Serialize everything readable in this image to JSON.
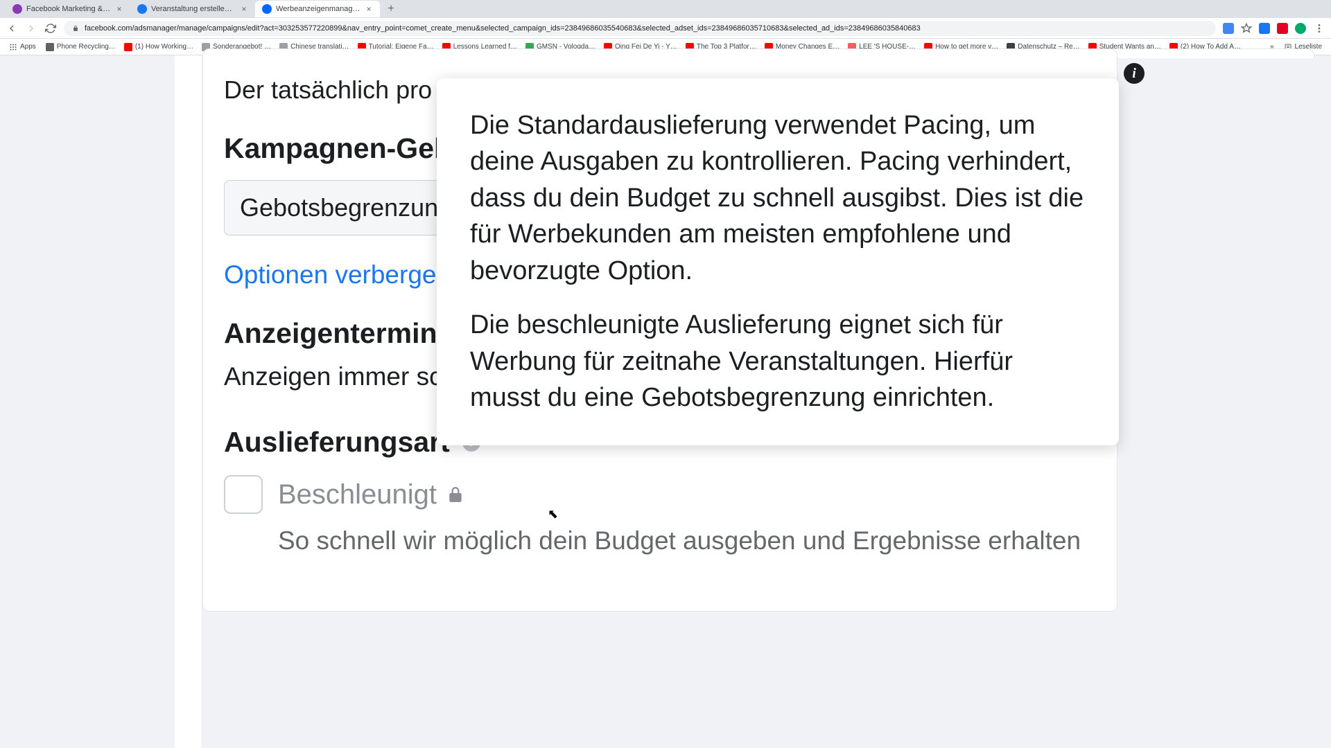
{
  "browser": {
    "tabs": [
      {
        "title": "Facebook Marketing & Werbe…",
        "favicon": "#8a3ab9"
      },
      {
        "title": "Veranstaltung erstellen | Face…",
        "favicon": "#1877f2"
      },
      {
        "title": "Werbeanzeigenmanager - We…",
        "favicon": "#0866ff"
      }
    ],
    "url": "facebook.com/adsmanager/manage/campaigns/edit?act=303253577220899&nav_entry_point=comet_create_menu&selected_campaign_ids=23849686035540683&selected_adset_ids=23849686035710683&selected_ad_ids=23849686035840683",
    "bookmarks_label": "Apps",
    "reading_list": "Leseliste",
    "bookmarks": [
      {
        "label": "Phone Recycling…",
        "color": "#5f6368"
      },
      {
        "label": "(1) How Working…",
        "color": "#ff0000"
      },
      {
        "label": "Sonderangebot! …",
        "color": "#9aa0a6"
      },
      {
        "label": "Chinese translati…",
        "color": "#9aa0a6"
      },
      {
        "label": "Tutorial: Eigene Fa…",
        "color": "#ff0000"
      },
      {
        "label": "Lessons Learned f…",
        "color": "#ff0000"
      },
      {
        "label": "GMSN - Vologda…",
        "color": "#34a853"
      },
      {
        "label": "Qing Fei De Yi - Y…",
        "color": "#ff0000"
      },
      {
        "label": "The Top 3 Platfor…",
        "color": "#ff0000"
      },
      {
        "label": "Money Changes E…",
        "color": "#ff0000"
      },
      {
        "label": "LEE 'S HOUSE-…",
        "color": "#ff5a5f"
      },
      {
        "label": "How to get more v…",
        "color": "#ff0000"
      },
      {
        "label": "Datenschutz – Re…",
        "color": "#3c4043"
      },
      {
        "label": "Student Wants an…",
        "color": "#ff0000"
      },
      {
        "label": "(2) How To Add A…",
        "color": "#ff0000"
      }
    ]
  },
  "page": {
    "sub_text": "Der tatsächlich pro Tag ausgegebene Betrag kann variieren.",
    "heading_bid": "Kampagnen-Gebotsstrategie",
    "dropdown_value": "Gebotsbegrenzung",
    "link_hide": "Optionen verbergen",
    "heading_schedule": "Anzeigenterminierung",
    "schedule_text": "Anzeigen immer schalten",
    "heading_delivery": "Auslieferungsart",
    "checkbox_label": "Beschleunigt",
    "checkbox_desc": "So schnell wir möglich dein Budget ausgeben und Ergebnisse erhalten"
  },
  "tooltip": {
    "p1": "Die Standardauslieferung verwendet Pacing, um deine Ausgaben zu kontrollieren. Pacing verhindert, dass du dein Budget zu schnell ausgibst. Dies ist die für Werbekunden am meisten empfohlene und bevorzugte Option.",
    "p2": "Die beschleunigte Auslieferung eignet sich für Werbung für zeitnahe Veranstaltungen. Hierfür musst du eine Gebotsbegrenzung einrichten."
  }
}
